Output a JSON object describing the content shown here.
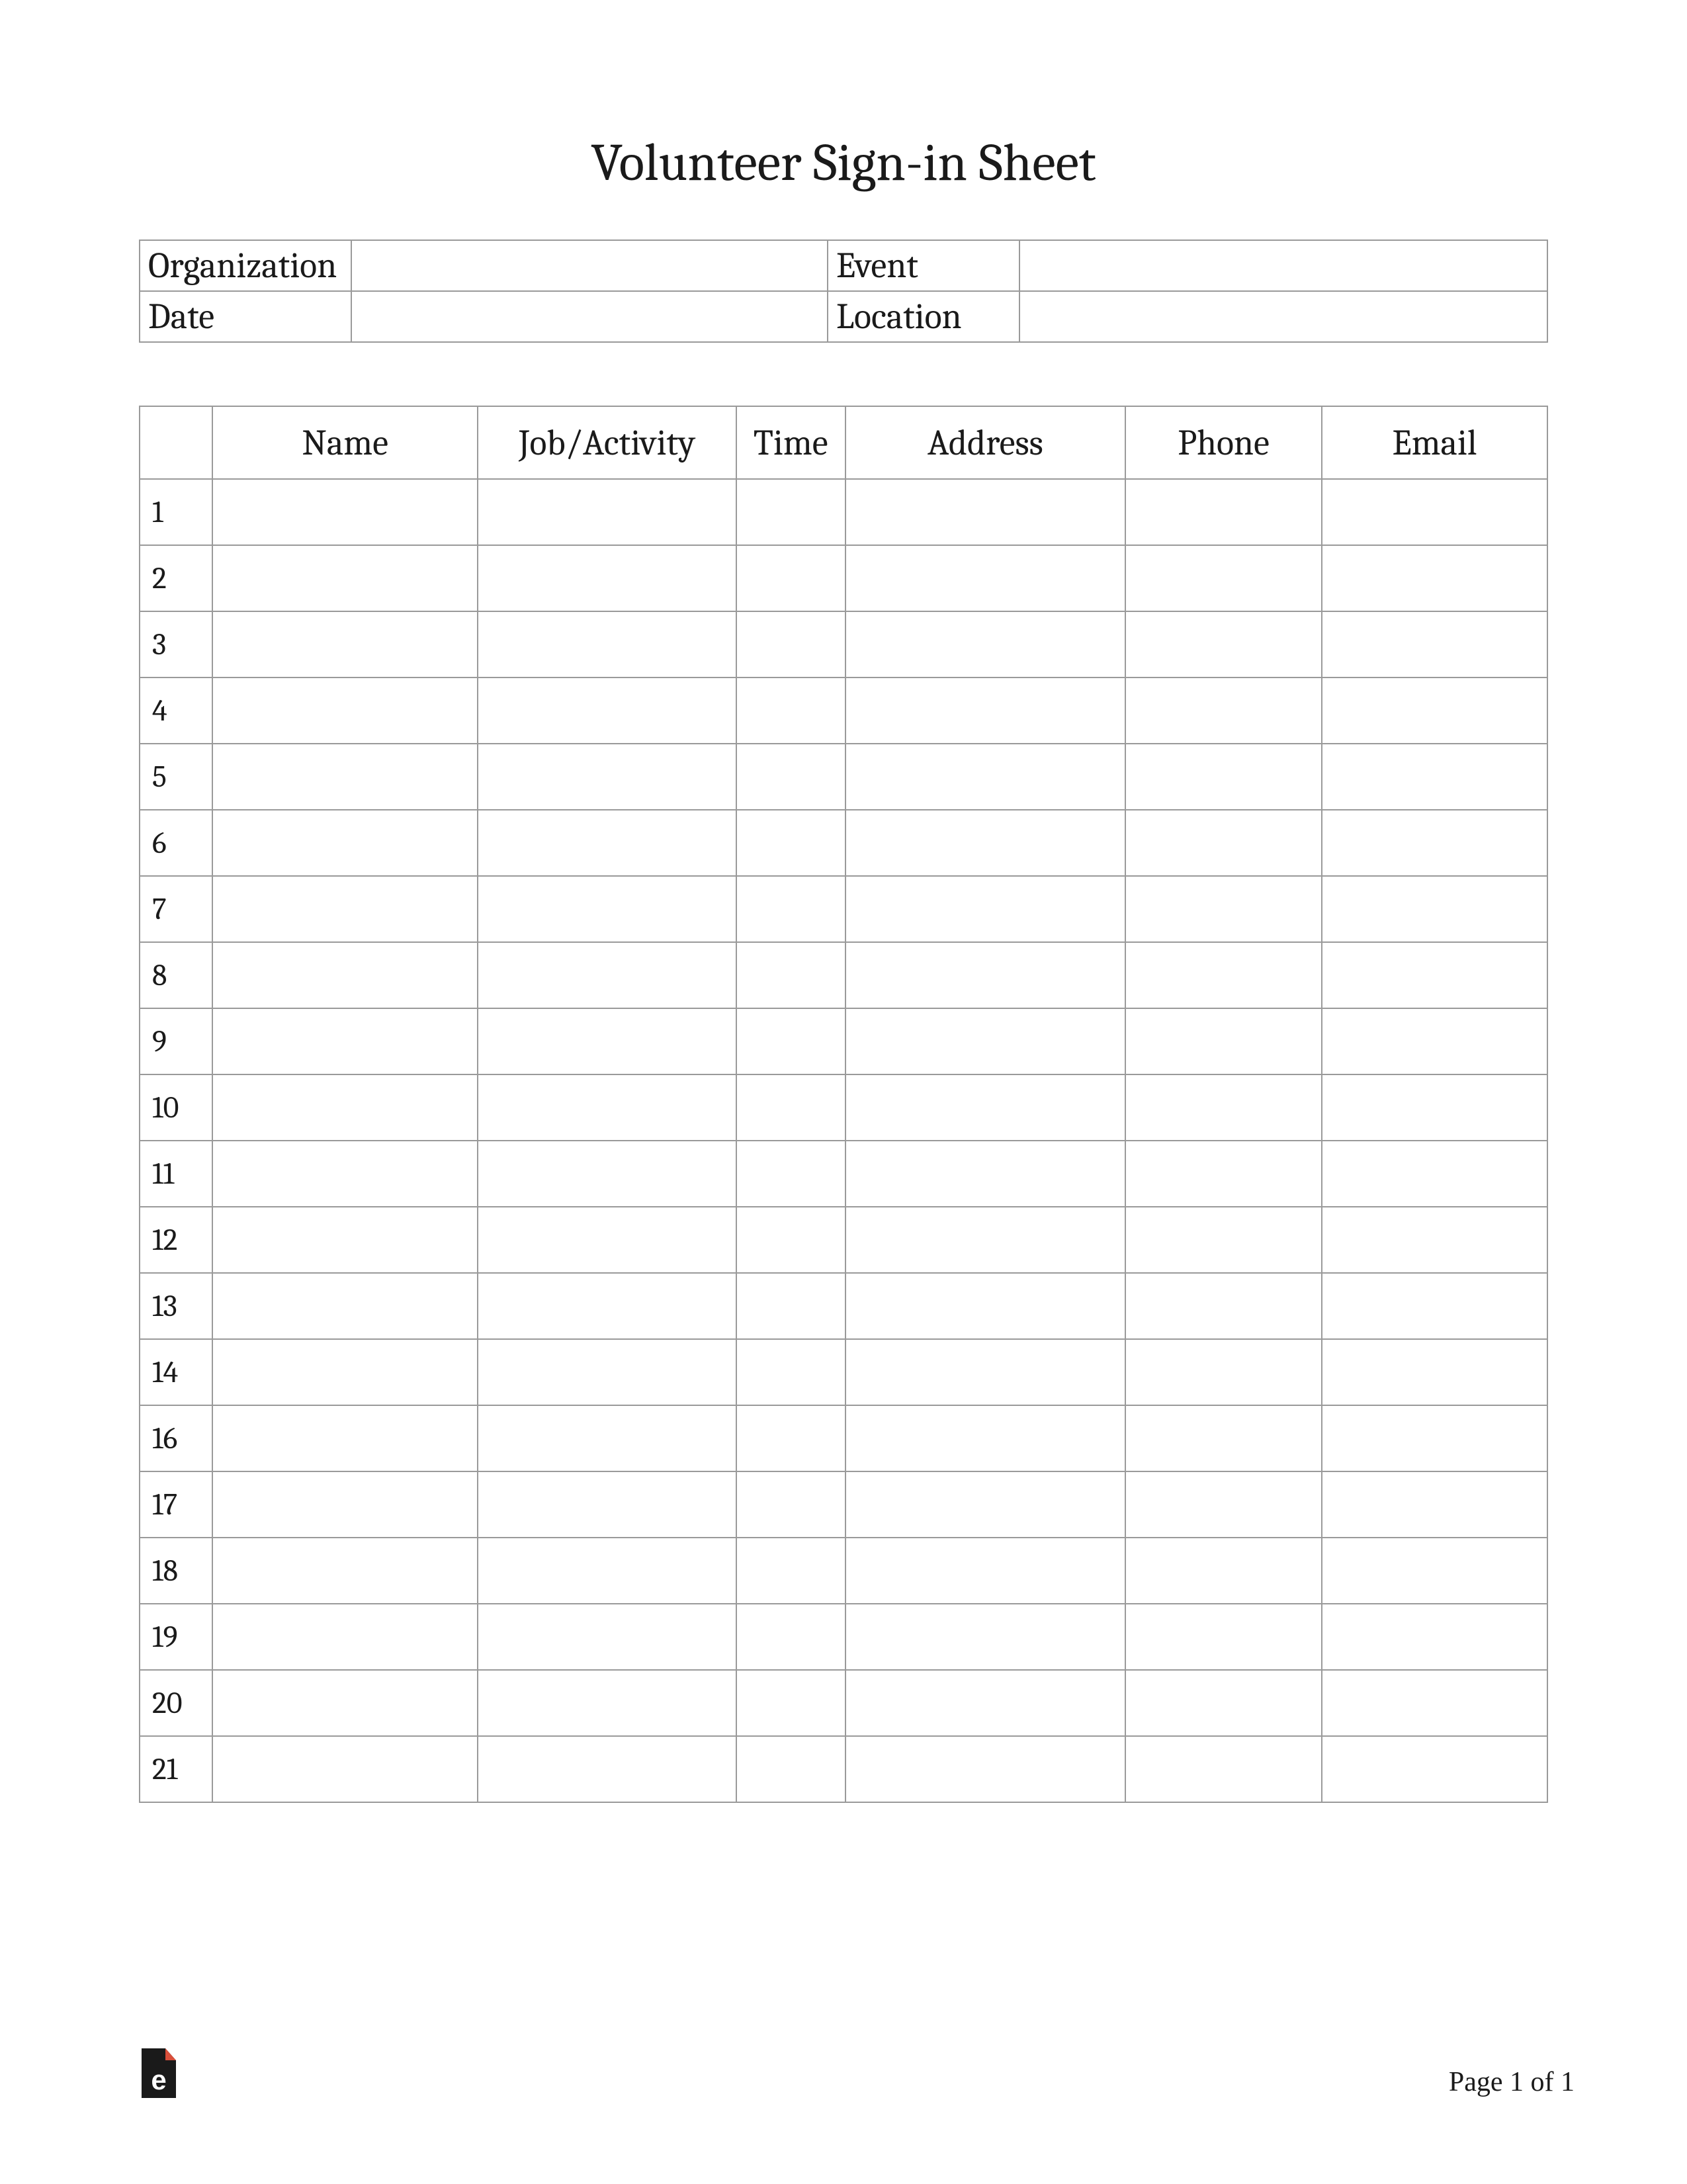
{
  "title": "Volunteer Sign-in Sheet",
  "info": {
    "organization_label": "Organization",
    "organization_value": "",
    "event_label": "Event",
    "event_value": "",
    "date_label": "Date",
    "date_value": "",
    "location_label": "Location",
    "location_value": ""
  },
  "columns": [
    "",
    "Name",
    "Job/Activity",
    "Time",
    "Address",
    "Phone",
    "Email"
  ],
  "row_numbers": [
    "1",
    "2",
    "3",
    "4",
    "5",
    "6",
    "7",
    "8",
    "9",
    "10",
    "11",
    "12",
    "13",
    "14",
    "16",
    "17",
    "18",
    "19",
    "20",
    "21"
  ],
  "footer": {
    "page_text": "Page 1 of 1"
  }
}
